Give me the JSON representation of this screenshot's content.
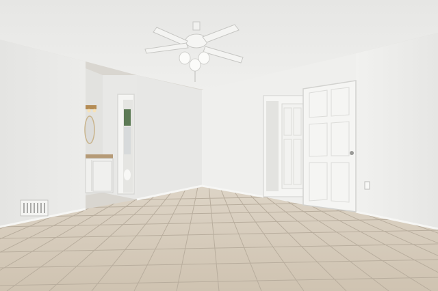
{
  "scene": {
    "description_type": "photo",
    "colors": {
      "ceiling": "#ebebe9",
      "wall_left": "#e9e9e7",
      "wall_back": "#efefed",
      "wall_right": "#eeeeec",
      "floor": "#d3c8b8",
      "grout": "#b8ad9d",
      "door": "#f4f4f2",
      "fan": "#f2f2f0",
      "vanity": "#f0f0ee",
      "countertop": "#b59a76"
    }
  }
}
